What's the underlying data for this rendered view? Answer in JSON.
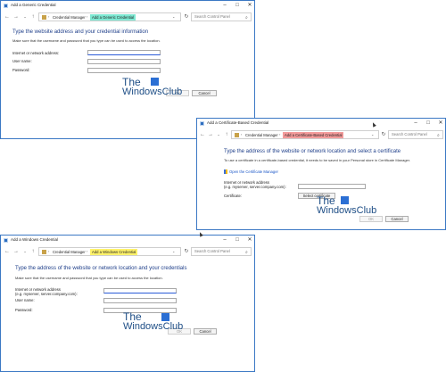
{
  "windows": {
    "generic": {
      "title": "Add a Generic Credential",
      "breadcrumb_root": "Credential Manager",
      "breadcrumb_current": "Add a Generic Credential",
      "highlight_color": "#7ee8d2",
      "search_placeholder": "Search Control Panel",
      "heading": "Type the website address and your credential information",
      "description": "Make sure that the username and password that you type can be used to access the location.",
      "fields": [
        {
          "label": "Internet or network address:",
          "value": ""
        },
        {
          "label": "User name:",
          "value": ""
        },
        {
          "label": "Password:",
          "value": ""
        }
      ],
      "ok_label": "OK",
      "cancel_label": "Cancel"
    },
    "certificate": {
      "title": "Add a Certificate-Based Credential",
      "breadcrumb_root": "Credential Manager",
      "breadcrumb_current": "Add a Certificate-Based Credential",
      "highlight_color": "#f49b9b",
      "search_placeholder": "Search Control Panel",
      "heading": "Type the address of the website or network location and select a certificate",
      "description": "To use a certificate in a certificate-based credential, it needs to be saved in your Personal store in Certificate Manager.",
      "link": "Open the Certificate Manager",
      "fields": [
        {
          "label": "Internet or network address\n(e.g. myserver, server.company.com):",
          "value": ""
        },
        {
          "label": "Certificate:",
          "value": ""
        }
      ],
      "select_label": "Select certificate",
      "ok_label": "OK",
      "cancel_label": "Cancel"
    },
    "windows": {
      "title": "Add a Windows Credential",
      "breadcrumb_root": "Credential Manager",
      "breadcrumb_current": "Add a Windows Credential",
      "highlight_color": "#fff36b",
      "search_placeholder": "Search Control Panel",
      "heading": "Type the address of the website or network location and your credentials",
      "description": "Make sure that the username and password that you type can be used to access the location.",
      "fields": [
        {
          "label": "Internet or network address\n(e.g. myserver, server.company.com):",
          "value": ""
        },
        {
          "label": "User name:",
          "value": ""
        },
        {
          "label": "Password:",
          "value": ""
        }
      ],
      "ok_label": "OK",
      "cancel_label": "Cancel"
    }
  },
  "watermark": {
    "line1": "The",
    "line2": "WindowsClub"
  },
  "icons": {
    "minimize": "minimize-icon",
    "maximize": "maximize-icon",
    "close": "close-icon",
    "back": "back-arrow-icon",
    "forward": "forward-arrow-icon",
    "up": "up-arrow-icon",
    "refresh": "refresh-icon",
    "search": "search-icon"
  }
}
